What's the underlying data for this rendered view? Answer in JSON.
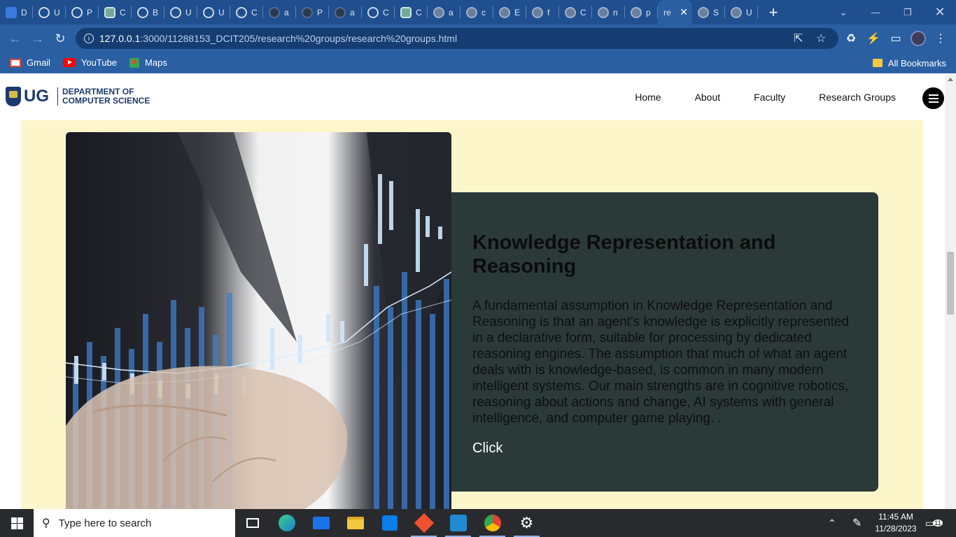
{
  "browser": {
    "tabs": [
      {
        "label": "D",
        "icon": "docs-icon"
      },
      {
        "label": "U",
        "icon": "loading-icon"
      },
      {
        "label": "P",
        "icon": "loading-icon"
      },
      {
        "label": "C",
        "icon": "chatgpt-icon"
      },
      {
        "label": "B",
        "icon": "site-icon"
      },
      {
        "label": "U",
        "icon": "site-icon"
      },
      {
        "label": "U",
        "icon": "site-icon"
      },
      {
        "label": "C",
        "icon": "site-icon"
      },
      {
        "label": "a",
        "icon": "github-icon"
      },
      {
        "label": "P",
        "icon": "github-icon"
      },
      {
        "label": "a",
        "icon": "github-icon"
      },
      {
        "label": "C",
        "icon": "site-icon"
      },
      {
        "label": "C",
        "icon": "chatgpt-icon"
      },
      {
        "label": "a",
        "icon": "globe-icon"
      },
      {
        "label": "c",
        "icon": "globe-icon"
      },
      {
        "label": "E",
        "icon": "globe-icon"
      },
      {
        "label": "f",
        "icon": "globe-icon"
      },
      {
        "label": "C",
        "icon": "globe-icon"
      },
      {
        "label": "n",
        "icon": "globe-icon"
      },
      {
        "label": "p",
        "icon": "globe-icon"
      },
      {
        "label": "re",
        "icon": "none",
        "active": true
      },
      {
        "label": "S",
        "icon": "globe-icon"
      },
      {
        "label": "U",
        "icon": "globe-icon"
      }
    ],
    "url_host": "127.0.0.1",
    "url_path": ":3000/11288153_DCIT205/research%20groups/research%20groups.html",
    "bookmarks": [
      {
        "label": "Gmail",
        "icon": "gmail-icon"
      },
      {
        "label": "YouTube",
        "icon": "youtube-icon"
      },
      {
        "label": "Maps",
        "icon": "maps-icon"
      }
    ],
    "all_bookmarks_label": "All Bookmarks"
  },
  "site": {
    "logo_abbr": "UG",
    "logo_line1": "DEPARTMENT OF",
    "logo_line2": "COMPUTER SCIENCE",
    "nav": [
      "Home",
      "About",
      "Faculty",
      "Research Groups"
    ],
    "section_bg": "#fdf6cb",
    "card_bg": "#2b3a39",
    "card": {
      "title": "Knowledge Representation and Reasoning",
      "body": "A fundamental assumption in Knowledge Representation and Reasoning is that an agent's knowledge is explicitly represented in a declarative form, suitable for processing by dedicated reasoning engines. The assumption that much of what an agent deals with is knowledge-based, is common in many modern intelligent systems. Our main strengths are in cognitive robotics, reasoning about actions and change, AI systems with general intelligence, and computer game playing. .",
      "link": "Click"
    }
  },
  "taskbar": {
    "search_placeholder": "Type here to search",
    "time": "11:45 AM",
    "date": "11/28/2023",
    "notification_count": "11"
  }
}
